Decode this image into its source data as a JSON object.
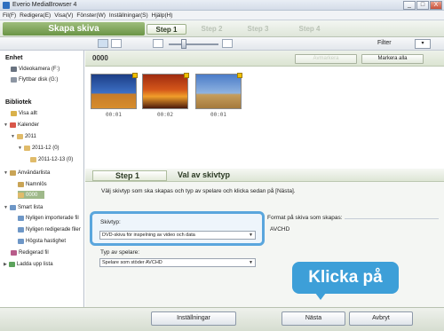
{
  "window": {
    "title": "Everio MediaBrowser 4",
    "buttons": [
      "_",
      "□",
      "X"
    ]
  },
  "menu": [
    "Fil(F)",
    "Redigera(E)",
    "Visa(V)",
    "Fönster(W)",
    "Inställningar(S)",
    "Hjälp(H)"
  ],
  "header": {
    "mode_title": "Skapa skiva",
    "steps": [
      "Step 1",
      "Step 2",
      "Step 3",
      "Step 4"
    ]
  },
  "toolbar": {
    "filter_label": "Filter"
  },
  "sidebar": {
    "device_heading": "Enhet",
    "devices": [
      "Videokamera (F:)",
      "Flyttbar disk (G:)"
    ],
    "library_heading": "Bibliotek",
    "items": {
      "view_all": "Visa allt",
      "calendar": "Kalender",
      "year": "2011",
      "month": "2011-12 (0)",
      "day": "2011-12-13 (0)",
      "user_lists": "Användarlista",
      "name_list": "Namnlös",
      "folder_0000": "0000",
      "smart_list": "Smart lista",
      "recent_imported": "Nyligen importerade fil",
      "recent_edited": "Nyligen redigerade filer",
      "highest_speed": "Högsta hastighet",
      "edited_file": "Redigerad fil",
      "upload_list": "Ladda upp lista"
    }
  },
  "content": {
    "folder_title": "0000",
    "unmark_label": "Avmarkera",
    "mark_all_label": "Markera alla",
    "thumbnails": [
      "00:01",
      "00:02",
      "00:01"
    ]
  },
  "wizard": {
    "step_label": "Step 1",
    "title": "Val av skivtyp",
    "instruction": "Välj skivtyp som ska skapas och typ av spelare och klicka sedan på [Nästa].",
    "disc_type_label": "Skivtyp:",
    "disc_type_value": "DVD-skiva för inspelning av video och data",
    "player_type_label": "Typ av spelare:",
    "player_type_value": "Spelare som stöder AVCHD",
    "format_title": "Format på skiva som skapas:",
    "format_value": "AVCHD"
  },
  "callout": "Klicka på",
  "bottom": {
    "settings": "Inställningar",
    "next": "Nästa",
    "cancel": "Avbryt"
  },
  "colors": {
    "accent_green": "#6a9445",
    "callout_blue": "#3d9fd8",
    "selected_item": "#9fb98a"
  }
}
